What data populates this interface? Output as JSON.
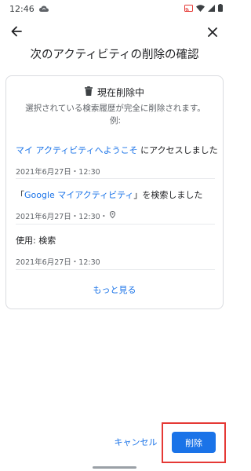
{
  "status_bar": {
    "time": "12:46",
    "icons": [
      "cloud-icon",
      "cast-icon",
      "wifi-icon",
      "signal-icon",
      "battery-icon"
    ]
  },
  "toolbar": {
    "back_icon": "arrow-back-icon",
    "close_icon": "close-icon"
  },
  "page": {
    "title": "次のアクティビティの削除の確認"
  },
  "card": {
    "header_icon": "trash-icon",
    "header": "現在削除中",
    "description_line1": "選択されている検索履歴が完全に削除されます。",
    "description_line2": "例:",
    "items": [
      {
        "link_text": "マイ アクティビティへようこそ",
        "suffix_text": " にアクセスしました",
        "meta": "2021年6月27日・12:30"
      },
      {
        "prefix_text": "「",
        "link_text": "Google マイアクティビティ",
        "suffix_text": "」を検索しました",
        "meta": "2021年6月27日・12:30・",
        "meta_icon": "location-pin-icon"
      },
      {
        "text": "使用: 検索",
        "meta": "2021年6月27日・12:30"
      }
    ],
    "more_label": "もっと見る"
  },
  "actions": {
    "cancel_label": "キャンセル",
    "delete_label": "削除",
    "highlight_color": "#e53935",
    "accent_color": "#1a73e8"
  }
}
